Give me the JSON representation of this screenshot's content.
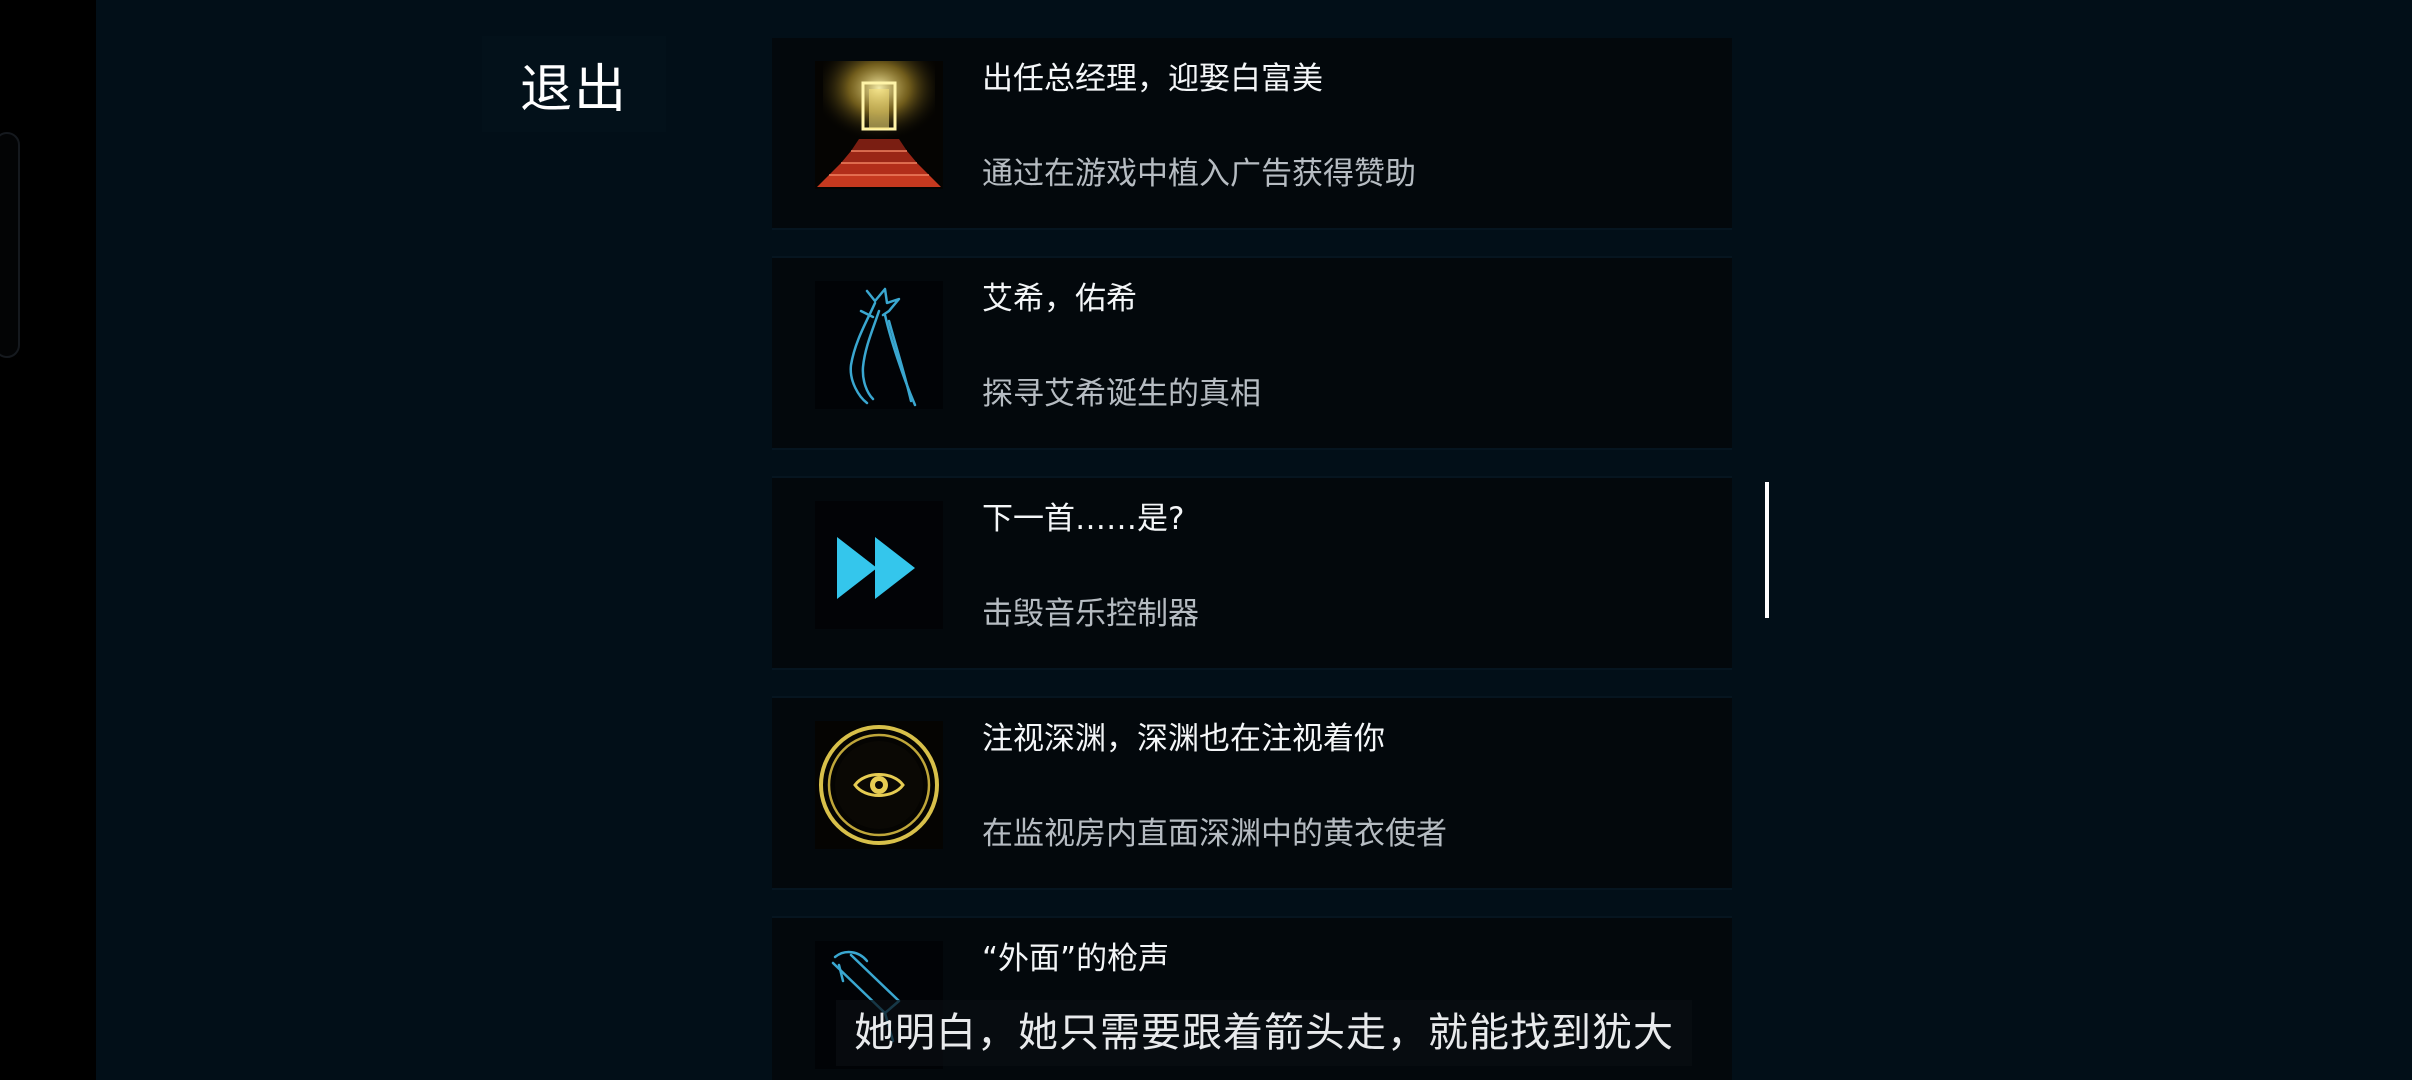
{
  "menu": {
    "exit_label": "退出"
  },
  "achievements": [
    {
      "title": "出任总经理，迎娶白富美",
      "description": "通过在游戏中植入广告获得赞助",
      "icon": "golden-staircase-door-icon"
    },
    {
      "title": "艾希，佑希",
      "description": "探寻艾希诞生的真相",
      "icon": "blue-scythe-figure-icon"
    },
    {
      "title": "下一首……是?",
      "description": "击毁音乐控制器",
      "icon": "fast-forward-icon"
    },
    {
      "title": "注视深渊，深渊也在注视着你",
      "description": "在监视房内直面深渊中的黄衣使者",
      "icon": "golden-eye-circle-icon"
    },
    {
      "title": "“外面”的枪声",
      "description": "",
      "icon": "blue-gun-icon"
    }
  ],
  "subtitle": {
    "text": "她明白，她只需要跟着箭头走，就能找到犹大"
  },
  "colors": {
    "background": "#020f18",
    "card": "#03080c",
    "accent_cyan": "#34c6ec",
    "accent_gold": "#d8c04a"
  }
}
